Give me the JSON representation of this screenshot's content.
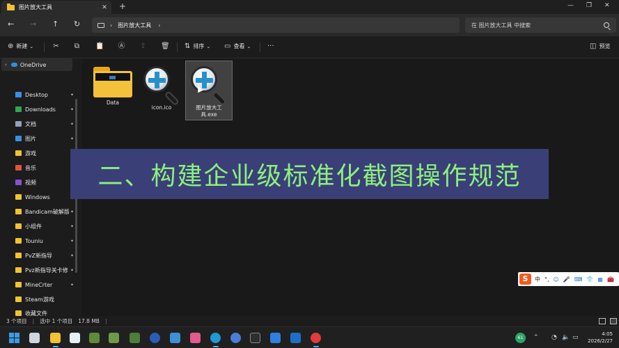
{
  "tab": {
    "title": "图片放大工具",
    "close": "✕",
    "new": "+"
  },
  "window_controls": {
    "minimize": "—",
    "maximize": "❐",
    "close": "✕"
  },
  "nav": {
    "back": "←",
    "forward": "→",
    "up": "↑",
    "refresh": "↻"
  },
  "address": {
    "separator": "›",
    "crumb": "图片放大工具",
    "crumb_sep_after": "›"
  },
  "search": {
    "placeholder": "在 图片放大工具 中搜索"
  },
  "toolbar": {
    "new_label": "新建",
    "new_arrow": "⌄",
    "sort_label": "排序",
    "view_label": "查看",
    "more": "···",
    "preview_label": "预览"
  },
  "sidebar": {
    "onedrive": "OneDrive",
    "items": [
      {
        "label": "Desktop",
        "color": "#3a8ee6"
      },
      {
        "label": "Downloads",
        "color": "#2fa84f"
      },
      {
        "label": "文档",
        "color": "#8fa3b8"
      },
      {
        "label": "图片",
        "color": "#3a8ee6"
      },
      {
        "label": "游戏",
        "color": "#f2c233"
      },
      {
        "label": "音乐",
        "color": "#e2543b"
      },
      {
        "label": "视频",
        "color": "#8a4fd8"
      },
      {
        "label": "Windows",
        "color": "#f2c233"
      },
      {
        "label": "Bandicam破解版",
        "color": "#f2c233"
      },
      {
        "label": "小组件",
        "color": "#f2c233"
      },
      {
        "label": "Touniu",
        "color": "#f2c233"
      },
      {
        "label": "PvZ新指导",
        "color": "#f2c233"
      },
      {
        "label": "Pvz新指导关卡修",
        "color": "#f2c233"
      },
      {
        "label": "MineCrter",
        "color": "#f2c233"
      },
      {
        "label": "Steam游戏",
        "color": "#f2c233"
      },
      {
        "label": "收藏文件",
        "color": "#f2c233"
      }
    ],
    "pin": "📌"
  },
  "files": [
    {
      "name": "Data"
    },
    {
      "name": "icon.ico"
    },
    {
      "name": "图片放大工具.exe"
    }
  ],
  "banner": {
    "text": "二、构建企业级标准化截图操作规范"
  },
  "ime": {
    "logo": "S",
    "mode": "中",
    "punct": "°,",
    "emoji": "☺",
    "mic": "🎤",
    "keyboard": "⌨",
    "skin": "👕",
    "grid": "▦",
    "tool": "🧰"
  },
  "status": {
    "count": "3 个项目",
    "selected": "选中 1 个项目",
    "size": "17.8 MB"
  },
  "tray": {
    "badge": "61",
    "clock_time": "4:05",
    "clock_date": "2026/2/27"
  },
  "colors": {
    "accent": "#3a8ee6",
    "banner_bg": "#3a3f78",
    "banner_text": "#8cf07c",
    "folder": "#f3c13a"
  }
}
